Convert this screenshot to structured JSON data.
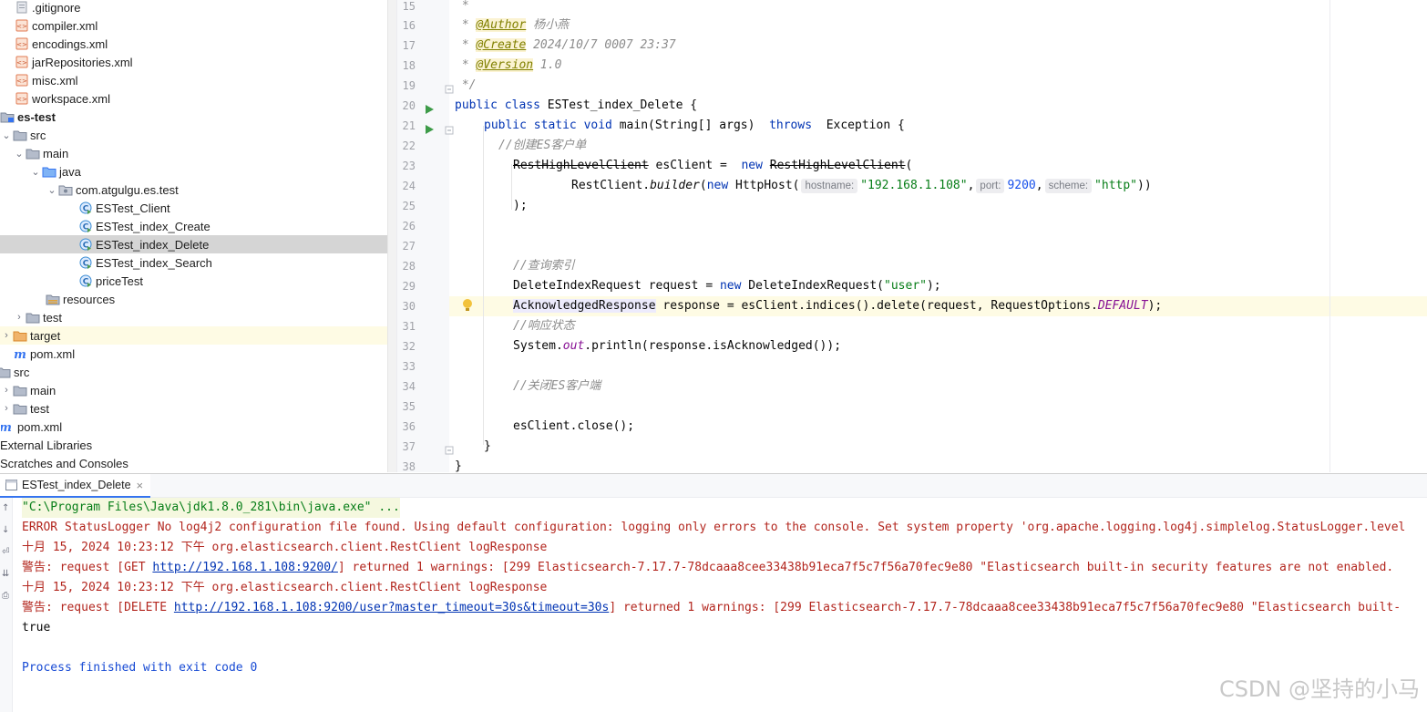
{
  "project_tree": {
    "items": [
      {
        "label": ".gitignore",
        "icon": "gitignore-file-icon",
        "expanded": null
      },
      {
        "label": "compiler.xml",
        "icon": "xml-file-icon",
        "expanded": null
      },
      {
        "label": "encodings.xml",
        "icon": "xml-file-icon",
        "expanded": null
      },
      {
        "label": "jarRepositories.xml",
        "icon": "xml-file-icon",
        "expanded": null
      },
      {
        "label": "misc.xml",
        "icon": "xml-file-icon",
        "expanded": null
      },
      {
        "label": "workspace.xml",
        "icon": "xml-file-icon",
        "expanded": null
      },
      {
        "label": "es-test",
        "icon": "module-folder-icon",
        "expanded": true
      },
      {
        "label": "src",
        "icon": "folder-icon",
        "expanded": true
      },
      {
        "label": "main",
        "icon": "folder-icon",
        "expanded": true
      },
      {
        "label": "java",
        "icon": "source-root-icon",
        "expanded": true
      },
      {
        "label": "com.atgulgu.es.test",
        "icon": "package-icon",
        "expanded": true
      },
      {
        "label": "ESTest_Client",
        "icon": "java-class-icon",
        "expanded": null
      },
      {
        "label": "ESTest_index_Create",
        "icon": "java-class-icon",
        "expanded": null
      },
      {
        "label": "ESTest_index_Delete",
        "icon": "java-class-icon",
        "expanded": null,
        "selected": true
      },
      {
        "label": "ESTest_index_Search",
        "icon": "java-class-icon",
        "expanded": null
      },
      {
        "label": "priceTest",
        "icon": "java-class-icon",
        "expanded": null
      },
      {
        "label": "resources",
        "icon": "resources-folder-icon",
        "expanded": null
      },
      {
        "label": "test",
        "icon": "folder-icon",
        "expanded": false
      },
      {
        "label": "target",
        "icon": "excluded-folder-icon",
        "expanded": false
      },
      {
        "label": "pom.xml",
        "icon": "maven-file-icon",
        "expanded": null
      },
      {
        "label": "src",
        "icon": "folder-icon",
        "expanded": true
      },
      {
        "label": "main",
        "icon": "folder-icon",
        "expanded": false
      },
      {
        "label": "test",
        "icon": "folder-icon",
        "expanded": false
      },
      {
        "label": "pom.xml",
        "icon": "maven-file-icon",
        "expanded": null
      },
      {
        "label": "External Libraries",
        "icon": "",
        "expanded": null
      },
      {
        "label": "Scratches and Consoles",
        "icon": "",
        "expanded": null
      }
    ]
  },
  "editor": {
    "line_numbers": [
      "15",
      "16",
      "17",
      "18",
      "19",
      "20",
      "21",
      "22",
      "23",
      "24",
      "25",
      "26",
      "27",
      "28",
      "29",
      "30",
      "31",
      "32",
      "33",
      "34",
      "35",
      "36",
      "37",
      "38"
    ],
    "line15": " *",
    "line16_prefix": " * ",
    "line16_tag": "@Author",
    "line16_value": " 杨小燕",
    "line17_prefix": " * ",
    "line17_tag": "@Create",
    "line17_value": " 2024/10/7 0007 23:37",
    "line18_prefix": " * ",
    "line18_tag": "@Version",
    "line18_value": " 1.0",
    "line19": " */",
    "line20_kw": "public class",
    "line20_rest": " ESTest_index_Delete {",
    "line21_kw": "public static void",
    "line21_a": " main(String[] args)  ",
    "line21_throws": "throws",
    "line21_b": "  Exception {",
    "line22": "//创建ES客户单",
    "line23_type": "RestHighLevelClient",
    "line23_mid": " esClient =  ",
    "line23_new": "new",
    "line23_space": " ",
    "line23_ctor": "RestHighLevelClient",
    "line23_end": "(",
    "line24_a": "RestClient.",
    "line24_builder": "builder",
    "line24_b": "(",
    "line24_new": "new",
    "line24_c": " HttpHost(",
    "line24_hint_host": "hostname:",
    "line24_host": "\"192.168.1.108\"",
    "line24_comma1": ",",
    "line24_hint_port": "port:",
    "line24_port": "9200",
    "line24_comma2": ",",
    "line24_hint_scheme": "scheme:",
    "line24_scheme": "\"http\"",
    "line24_end": "))",
    "line25": ");",
    "line28": "//查询索引",
    "line29_a": "DeleteIndexRequest request = ",
    "line29_new": "new",
    "line29_b": " DeleteIndexRequest(",
    "line29_str": "\"user\"",
    "line29_end": ");",
    "line30_type": "AcknowledgedResponse",
    "line30_a": " response = esClient.indices().delete(request, RequestOptions.",
    "line30_const": "DEFAULT",
    "line30_end": ");",
    "line31": "//响应状态",
    "line32_a": "System.",
    "line32_out": "out",
    "line32_b": ".println(response.isAcknowledged());",
    "line34": "//关闭ES客户端",
    "line36": "esClient.close();",
    "line37": "}",
    "line38": "}"
  },
  "run_panel": {
    "tab_label": "ESTest_index_Delete",
    "close_glyph": "×",
    "cmd": "\"C:\\Program Files\\Java\\jdk1.8.0_281\\bin\\java.exe\" ...",
    "line2": "ERROR StatusLogger No log4j2 configuration file found. Using default configuration: logging only errors to the console. Set system property 'org.apache.logging.log4j.simplelog.StatusLogger.level",
    "line3": "十月 15, 2024 10:23:12 下午 org.elasticsearch.client.RestClient logResponse",
    "line4_a": "警告: request [GET ",
    "line4_link": "http://192.168.1.108:9200/",
    "line4_b": "] returned 1 warnings: [299 Elasticsearch-7.17.7-78dcaaa8cee33438b91eca7f5c7f56a70fec9e80 \"Elasticsearch built-in security features are not enabled.",
    "line5": "十月 15, 2024 10:23:12 下午 org.elasticsearch.client.RestClient logResponse",
    "line6_a": "警告: request [DELETE ",
    "line6_link": "http://192.168.1.108:9200/user?master_timeout=30s&timeout=30s",
    "line6_b": "] returned 1 warnings: [299 Elasticsearch-7.17.7-78dcaaa8cee33438b91eca7f5c7f56a70fec9e80 \"Elasticsearch built-",
    "line7": "true",
    "line9": "Process finished with exit code 0"
  },
  "watermark": "CSDN @坚持的小马",
  "colors": {
    "keyword": "#0033b3",
    "string": "#067d17",
    "number": "#1750eb",
    "comment": "#8c8c8c",
    "error_output": "#b3261e",
    "selected_row": "#d5d5d5",
    "caret_line": "#fefbe4"
  }
}
